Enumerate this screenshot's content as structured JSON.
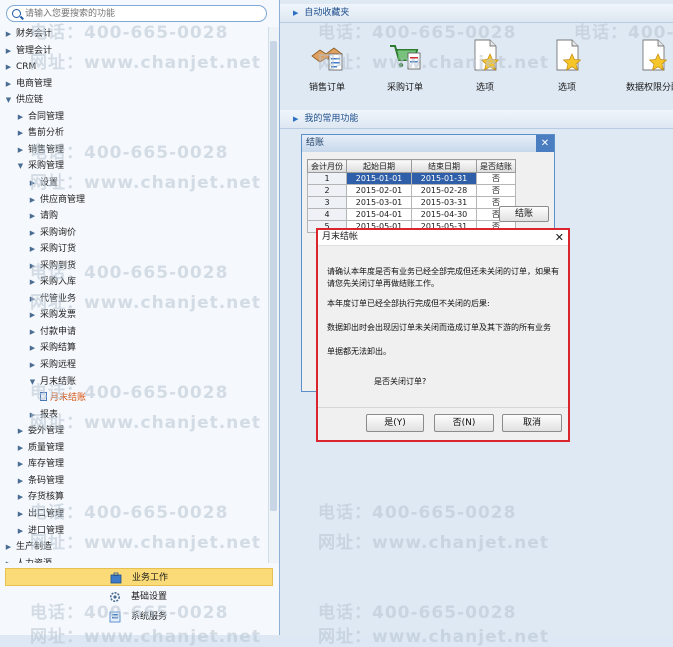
{
  "search": {
    "placeholder": "请输入您要搜索的功能"
  },
  "tree": [
    {
      "label": "财务会计",
      "level": 1,
      "state": "collapsed"
    },
    {
      "label": "管理会计",
      "level": 1,
      "state": "collapsed"
    },
    {
      "label": "CRM",
      "level": 1,
      "state": "collapsed"
    },
    {
      "label": "电商管理",
      "level": 1,
      "state": "collapsed"
    },
    {
      "label": "供应链",
      "level": 1,
      "state": "expanded"
    },
    {
      "label": "合同管理",
      "level": 2,
      "state": "collapsed"
    },
    {
      "label": "售前分析",
      "level": 2,
      "state": "collapsed"
    },
    {
      "label": "销售管理",
      "level": 2,
      "state": "collapsed"
    },
    {
      "label": "采购管理",
      "level": 2,
      "state": "expanded"
    },
    {
      "label": "设置",
      "level": 3,
      "state": "collapsed"
    },
    {
      "label": "供应商管理",
      "level": 3,
      "state": "collapsed"
    },
    {
      "label": "请购",
      "level": 3,
      "state": "collapsed"
    },
    {
      "label": "采购询价",
      "level": 3,
      "state": "collapsed"
    },
    {
      "label": "采购订货",
      "level": 3,
      "state": "collapsed"
    },
    {
      "label": "采购到货",
      "level": 3,
      "state": "collapsed"
    },
    {
      "label": "采购入库",
      "level": 3,
      "state": "collapsed"
    },
    {
      "label": "代管业务",
      "level": 3,
      "state": "collapsed"
    },
    {
      "label": "采购发票",
      "level": 3,
      "state": "collapsed"
    },
    {
      "label": "付款申请",
      "level": 3,
      "state": "collapsed"
    },
    {
      "label": "采购结算",
      "level": 3,
      "state": "collapsed"
    },
    {
      "label": "采购远程",
      "level": 3,
      "state": "collapsed"
    },
    {
      "label": "月末结账",
      "level": 3,
      "state": "expanded"
    },
    {
      "label": "月末结账",
      "level": 4,
      "state": "leaf",
      "selected": true
    },
    {
      "label": "报表",
      "level": 3,
      "state": "collapsed"
    },
    {
      "label": "委外管理",
      "level": 2,
      "state": "collapsed"
    },
    {
      "label": "质量管理",
      "level": 2,
      "state": "collapsed"
    },
    {
      "label": "库存管理",
      "level": 2,
      "state": "collapsed"
    },
    {
      "label": "条码管理",
      "level": 2,
      "state": "collapsed"
    },
    {
      "label": "存货核算",
      "level": 2,
      "state": "collapsed"
    },
    {
      "label": "出口管理",
      "level": 2,
      "state": "collapsed"
    },
    {
      "label": "进口管理",
      "level": 2,
      "state": "collapsed"
    },
    {
      "label": "生产制造",
      "level": 1,
      "state": "collapsed"
    },
    {
      "label": "人力资源",
      "level": 1,
      "state": "collapsed"
    }
  ],
  "bottom_nav": [
    {
      "label": "业务工作",
      "icon": "business-icon",
      "active": true
    },
    {
      "label": "基础设置",
      "icon": "gear-icon",
      "active": false
    },
    {
      "label": "系统服务",
      "icon": "service-icon",
      "active": false
    }
  ],
  "favorites_header": "自动收藏夹",
  "favorites": [
    {
      "label": "销售订单",
      "icon": "sales-order-icon"
    },
    {
      "label": "采购订单",
      "icon": "purchase-order-icon"
    },
    {
      "label": "选项",
      "icon": "options-icon"
    },
    {
      "label": "选项",
      "icon": "options-icon"
    },
    {
      "label": "数据权限分配",
      "icon": "data-permission-icon"
    }
  ],
  "common_header": "我的常用功能",
  "watermark": {
    "phone": "电话：400-665-0028",
    "site": "网址：www.chanjet.net"
  },
  "closing_window": {
    "title": "结账",
    "columns": [
      "会计月份",
      "起始日期",
      "结束日期",
      "是否结账"
    ],
    "rows": [
      {
        "month": "1",
        "start": "2015-01-01",
        "end": "2015-01-31",
        "closed": "否"
      },
      {
        "month": "2",
        "start": "2015-02-01",
        "end": "2015-02-28",
        "closed": "否"
      },
      {
        "month": "3",
        "start": "2015-03-01",
        "end": "2015-03-31",
        "closed": "否"
      },
      {
        "month": "4",
        "start": "2015-04-01",
        "end": "2015-04-30",
        "closed": "否"
      },
      {
        "month": "5",
        "start": "2015-05-01",
        "end": "2015-05-31",
        "closed": "否"
      }
    ],
    "close_button": "结账"
  },
  "dialog": {
    "title": "月末结帐",
    "lines": [
      "请确认本年度是否有业务已经全部完成但还未关闭的订单，如果有请您先关闭订单再做结账工作。",
      "本年度订单已经全部执行完成但不关闭的后果:",
      "数据卸出时会出现因订单未关闭而造成订单及其下游的所有业务",
      "单据都无法卸出。",
      "是否关闭订单?"
    ],
    "buttons": {
      "yes": "是(Y)",
      "no": "否(N)",
      "cancel": "取消"
    }
  },
  "colors": {
    "accent": "#2f5fa8",
    "selected_text": "#d8500a",
    "dialog_border": "#d9262e",
    "active_nav": "#fadb77"
  }
}
